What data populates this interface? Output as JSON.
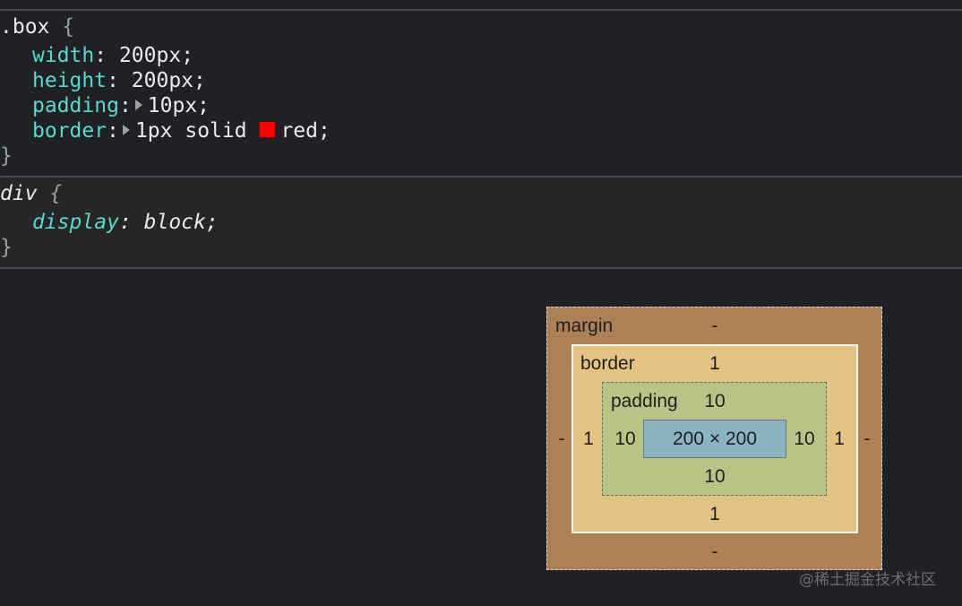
{
  "styles": {
    "rule1": {
      "selector": ".box",
      "open_brace": "{",
      "close_brace": "}",
      "declarations": [
        {
          "property": "width",
          "value": "200px;"
        },
        {
          "property": "height",
          "value": "200px;"
        },
        {
          "property": "padding",
          "value": "10px;"
        },
        {
          "property": "border",
          "value_prefix": "1px solid",
          "color_swatch": "#ff0000",
          "value_suffix": "red;"
        }
      ]
    },
    "rule2": {
      "selector": "div",
      "open_brace": "{",
      "close_brace": "}",
      "declarations": [
        {
          "property": "display",
          "value": "block;"
        }
      ]
    }
  },
  "box_model": {
    "margin": {
      "label": "margin",
      "top": "-",
      "right": "-",
      "bottom": "-",
      "left": "-"
    },
    "border": {
      "label": "border",
      "top": "1",
      "right": "1",
      "bottom": "1",
      "left": "1"
    },
    "padding": {
      "label": "padding",
      "top": "10",
      "right": "10",
      "bottom": "10",
      "left": "10"
    },
    "content": {
      "size": "200 × 200"
    },
    "colors": {
      "margin": "#ad8155",
      "border": "#e3c283",
      "padding": "#b8c485",
      "content": "#8bb4c2"
    }
  },
  "watermark": "@稀土掘金技术社区"
}
